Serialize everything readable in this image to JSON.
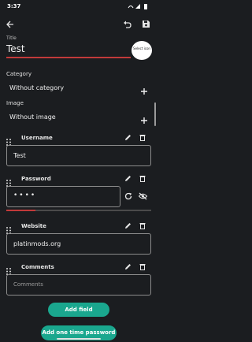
{
  "status": {
    "time": "3:37"
  },
  "title_field": {
    "label": "Title",
    "value": "Test"
  },
  "select_icon": {
    "label": "Select icon"
  },
  "category": {
    "label": "Category",
    "value": "Without category"
  },
  "image": {
    "label": "Image",
    "value": "Without image"
  },
  "fields": [
    {
      "name": "Username",
      "value": "Test"
    },
    {
      "name": "Password",
      "value": "••••",
      "strength": 0.2
    },
    {
      "name": "Website",
      "value": "platinmods.org"
    },
    {
      "name": "Comments",
      "placeholder": "Comments"
    }
  ],
  "buttons": {
    "add_field": "Add field",
    "add_otp": "Add one time password"
  },
  "colors": {
    "accent": "#1aa78e",
    "title_underline": "#c23a3a",
    "background": "#1b1d20"
  },
  "icons": [
    "back-arrow-icon",
    "undo-icon",
    "save-icon",
    "plus-icon",
    "drag-handle-icon",
    "edit-icon",
    "delete-icon",
    "refresh-icon",
    "visibility-off-icon"
  ]
}
